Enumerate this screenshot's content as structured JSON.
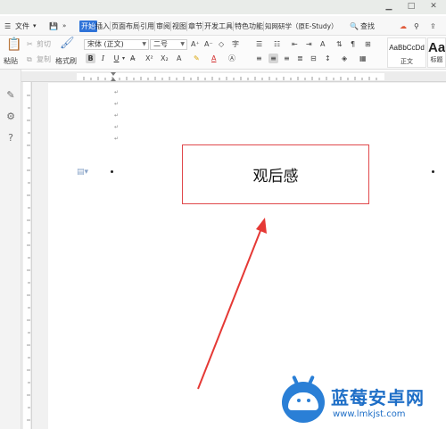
{
  "menu": {
    "file_label": "文件",
    "tabs": [
      "开始",
      "插入",
      "页面布局",
      "引用",
      "审阅",
      "视图",
      "章节",
      "开发工具",
      "特色功能",
      "知网研学（原E-Study）"
    ],
    "search_label": "查找"
  },
  "ribbon": {
    "paste_label": "粘贴",
    "cut_label": "剪切",
    "copy_label": "复制",
    "format_painter_label": "格式刷",
    "font_name": "宋体 (正文)",
    "font_size": "二号",
    "bold": "B",
    "italic": "I",
    "underline": "U",
    "styles": [
      {
        "sample": "AaBbCcDd",
        "name": "正文"
      },
      {
        "sample": "Aa",
        "name": "标题"
      }
    ]
  },
  "document": {
    "textbox_text": "观后感"
  },
  "watermark": {
    "name": "蓝莓安卓网",
    "url": "www.lmkjst.com"
  },
  "colors": {
    "accent_tab": "#2f73d8",
    "textbox_border": "#e0484b",
    "arrow": "#e53935",
    "watermark": "#1f6fc7"
  }
}
